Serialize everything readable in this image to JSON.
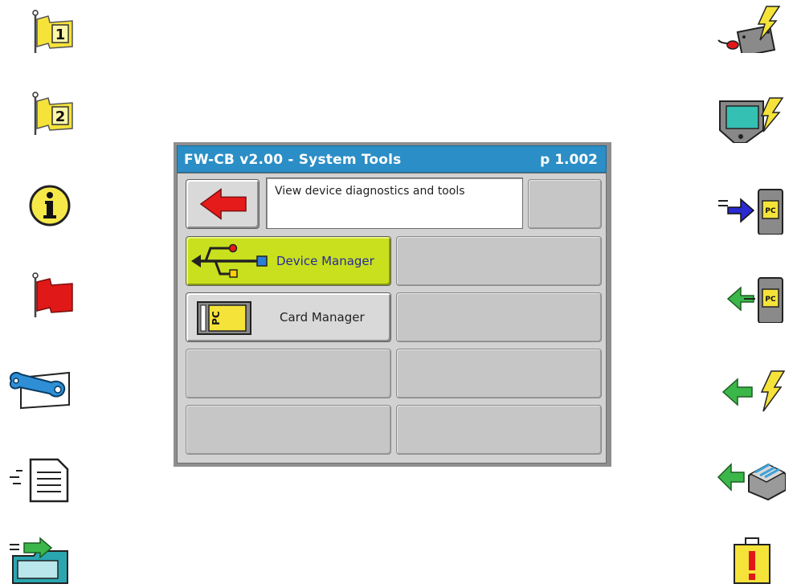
{
  "window": {
    "title": "FW-CB v2.00 - System Tools",
    "page": "p 1.002",
    "description": "View device diagnostics and tools"
  },
  "buttons": {
    "device_manager": "Device Manager",
    "card_manager": "Card Manager"
  },
  "left_icons": [
    "flag-1-icon",
    "flag-2-icon",
    "info-icon",
    "red-flag-icon",
    "wrench-settings-icon",
    "document-list-icon",
    "folder-import-icon"
  ],
  "right_icons": [
    "device-power-icon",
    "terminal-power-icon",
    "send-to-pc-card-icon",
    "receive-from-pc-card-icon",
    "receive-power-icon",
    "receive-archive-icon",
    "alert-clipboard-icon"
  ],
  "colors": {
    "title_bar": "#2b8ec6",
    "selected_button": "#c8e01e",
    "back_arrow": "#e51a1a",
    "flag_yellow": "#f5e33a",
    "flag_red": "#e01818"
  }
}
